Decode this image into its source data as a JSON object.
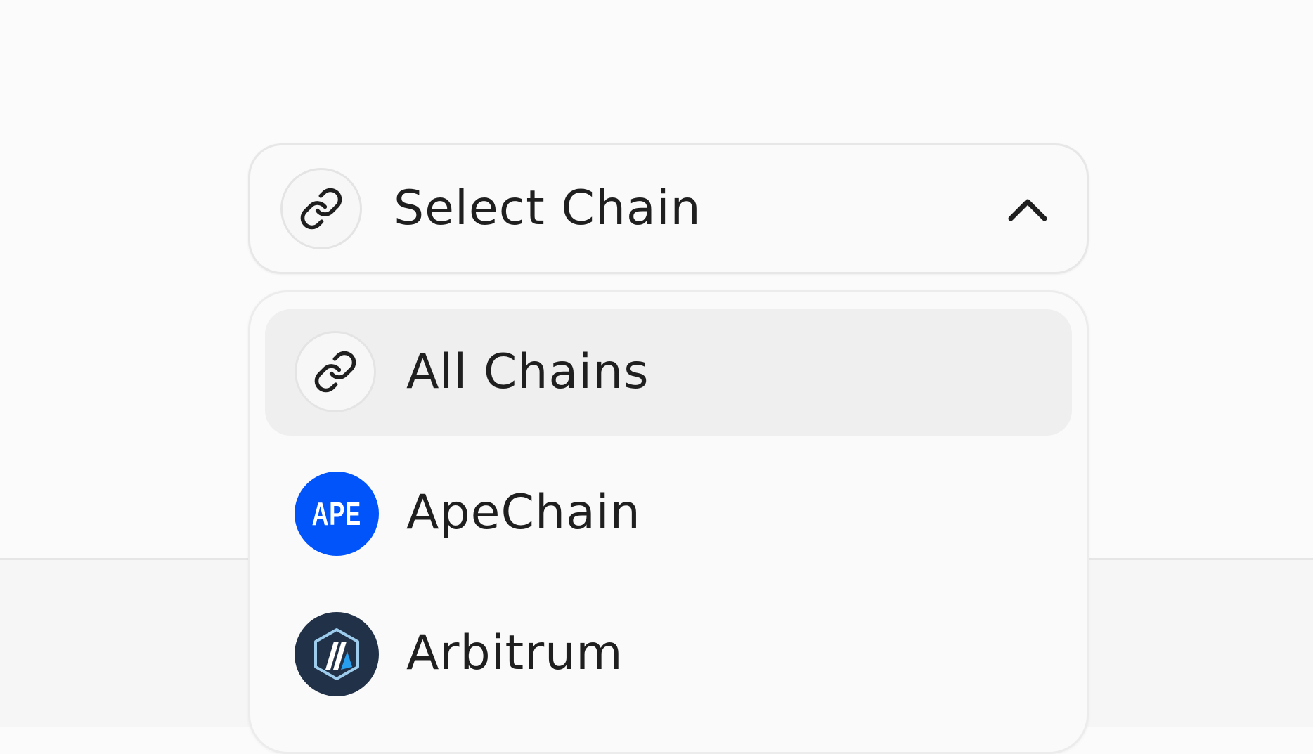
{
  "select": {
    "label": "Select Chain",
    "icon": "link-icon",
    "state": "expanded"
  },
  "menu": {
    "items": [
      {
        "label": "All Chains",
        "icon": "link-icon",
        "selected": true
      },
      {
        "label": "ApeChain",
        "icon": "apechain-logo",
        "logo_text": "APE",
        "color": "#0054fa"
      },
      {
        "label": "Arbitrum",
        "icon": "arbitrum-logo",
        "color": "#213147"
      }
    ]
  },
  "colors": {
    "background": "#fbfbfb",
    "selected_item": "#efefef",
    "text": "#1f1f1f",
    "ape_blue": "#0054fa",
    "arbitrum_navy": "#213147",
    "arbitrum_blue": "#28a0f0"
  }
}
